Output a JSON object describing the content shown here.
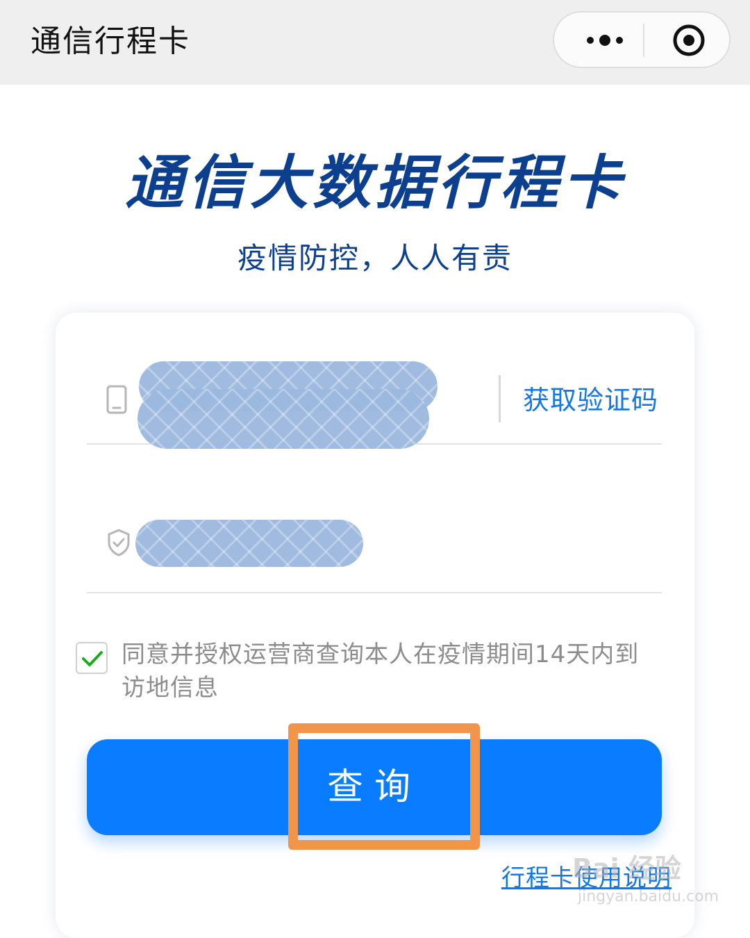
{
  "navbar": {
    "title": "通信行程卡",
    "more_icon": "more-dots-icon",
    "close_icon": "close-target-icon"
  },
  "hero": {
    "title": "通信大数据行程卡",
    "subtitle": "疫情防控，人人有责"
  },
  "form": {
    "phone": {
      "icon": "phone-icon",
      "value": "",
      "redacted": true
    },
    "code": {
      "icon": "shield-check-icon",
      "value": "",
      "redacted": true
    },
    "get_code_label": "获取验证码",
    "agreement_checked": true,
    "agreement_text": "同意并授权运营商查询本人在疫情期间14天内到访地信息",
    "query_label": "查询",
    "help_link": "行程卡使用说明"
  },
  "watermark": {
    "main": "Bai 经验",
    "sub": "jingyan.baidu.com"
  },
  "colors": {
    "primary": "#0a7cff",
    "title_blue": "#0d3f8f",
    "link_blue": "#1577e6",
    "highlight_orange": "#f0954a",
    "check_green": "#1aad19"
  }
}
